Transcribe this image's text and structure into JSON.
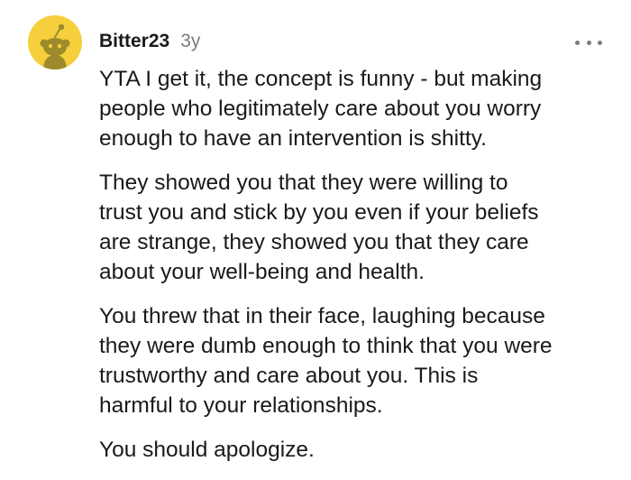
{
  "comment": {
    "author": "Bitter23",
    "age": "3y",
    "avatar_icon": "reddit-snoo-avatar-icon",
    "more_icon": "more-options-icon",
    "colors": {
      "avatar_bg": "#f5cf3c",
      "text": "#1a1a1b",
      "muted": "#7c7c7c"
    },
    "paragraphs": [
      {
        "lines": [
          "YTA I get it, the concept is funny - but making",
          "people who legitimately care about you worry",
          "enough to have an intervention is shitty."
        ]
      },
      {
        "lines": [
          "They showed you that they were willing to",
          "trust you and stick by you even if your beliefs",
          "are strange, they showed you that they care",
          "about your well-being and health."
        ]
      },
      {
        "lines": [
          "You threw that in their face, laughing because",
          "they were dumb enough to think that you were",
          "trustworthy and care about you. This is",
          "harmful to your relationships."
        ]
      },
      {
        "lines": [
          "You should apologize."
        ]
      }
    ]
  }
}
